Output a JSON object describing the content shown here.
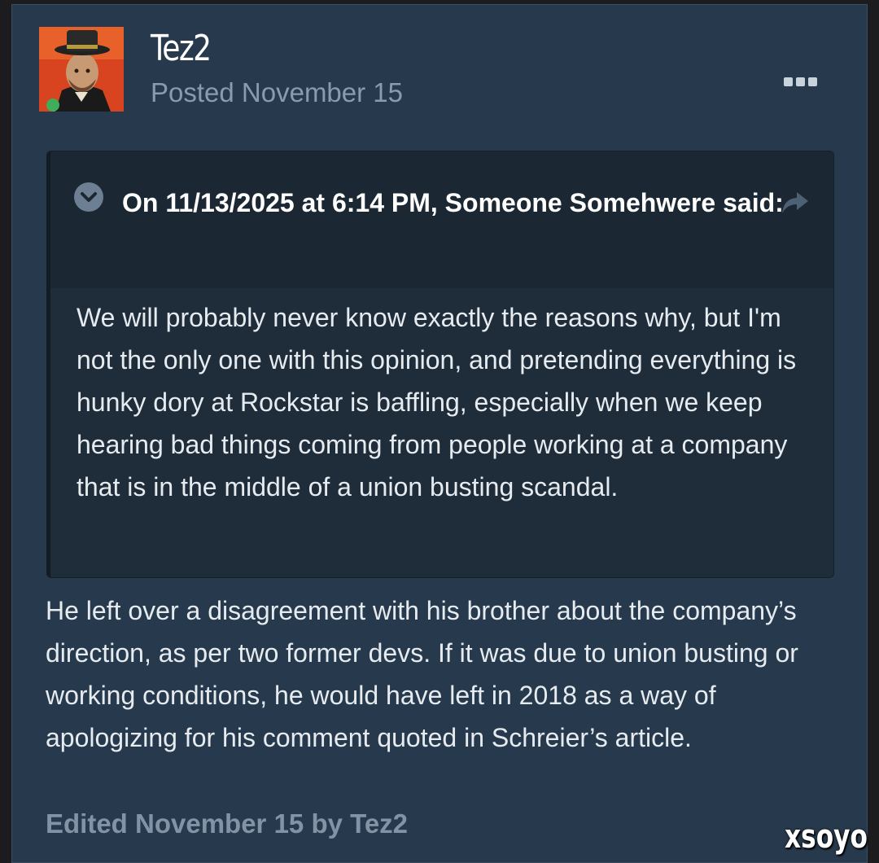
{
  "post": {
    "author": "Tez2",
    "posted": "Posted November 15",
    "avatar_icon": "avatar-character-portrait",
    "more_menu_icon": "more-options-icon",
    "quote": {
      "citation": "On 11/13/2025 at 6:14 PM, Someone Somehwere said:",
      "body": "We will probably never know exactly the reasons why, but I'm not the only one with this opinion, and pretending everything is hunky dory at Rockstar is baffling, especially when we keep hearing bad things coming from people working at a company that is in the middle of a union busting scandal."
    },
    "reply": "He left over a disagreement with his brother about the company’s direction, as per two former devs. If it was due to union busting or working conditions, he would have left in 2018 as a way of apologizing for his comment quoted in Schreier’s article.",
    "edited": "Edited November 15 by Tez2"
  },
  "watermark": "xsoyo",
  "colors": {
    "post_bg": "#27394c",
    "quote_bg": "#1f2c3a",
    "muted_text": "#8a9bad",
    "text": "#e6ebf0"
  }
}
